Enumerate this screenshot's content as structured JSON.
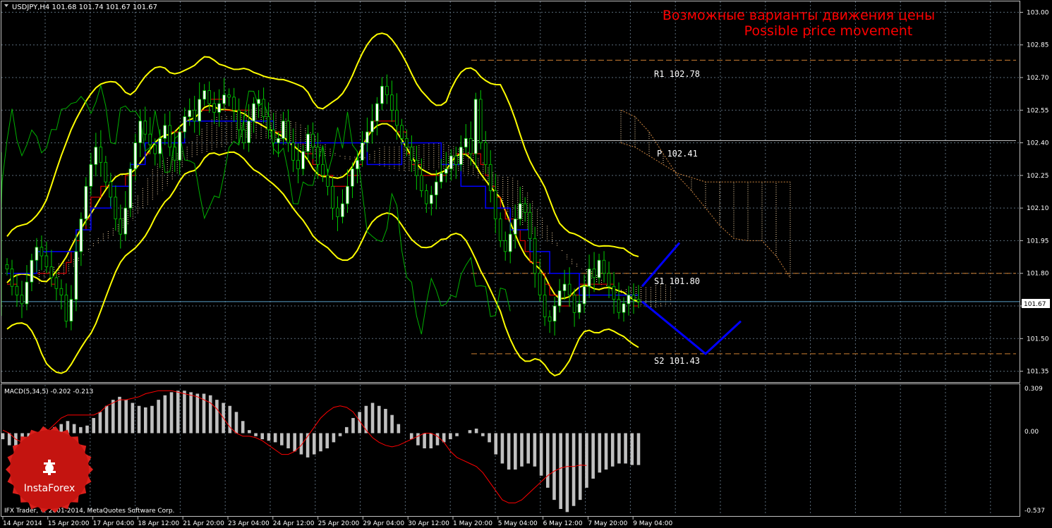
{
  "colors": {
    "background": "#000000",
    "grid": "#5a6b7a",
    "border": "#c0c0c0",
    "text": "#ffffff",
    "bull": "#ffffff",
    "bear": "#000000",
    "candle_outline": "#00cc00",
    "bollinger": "#ffff00",
    "tenkan": "#ff0000",
    "kijun": "#0000ff",
    "chikou": "#00b000",
    "kumo": "#ffdead",
    "kumo_edge": "#cd853f",
    "level_line": "#cd7f32",
    "pivot_line": "#c0c0c0",
    "bid_line": "#5aa0c8",
    "forecast": "#0000ff",
    "annotation": "#ff0000",
    "macd_hist": "#c0c0c0",
    "macd_signal": "#ff0000",
    "logo_red": "#d9201c"
  },
  "header": {
    "symbol_info": "USDJPY,H4  101.68 101.74 101.67 101.67"
  },
  "annotation": {
    "line1": "Возможные варианты движения цены",
    "line2": "Possible price movement"
  },
  "levels": [
    {
      "name": "R1",
      "label": "R1 102.78",
      "price": 102.78
    },
    {
      "name": "P",
      "label": "P 102.41",
      "price": 102.41
    },
    {
      "name": "S1",
      "label": "S1 101.80",
      "price": 101.8
    },
    {
      "name": "S2",
      "label": "S2 101.43",
      "price": 101.43
    }
  ],
  "price_axis": {
    "ticks": [
      "103.00",
      "102.85",
      "102.70",
      "102.55",
      "102.40",
      "102.25",
      "102.10",
      "101.95",
      "101.80",
      "101.65",
      "101.50",
      "101.35"
    ],
    "current": "101.67",
    "min": 101.3,
    "max": 103.05
  },
  "macd": {
    "label": "MACD(5,34,5) -0.202 -0.213",
    "ticks": [
      "0.309",
      "0.00",
      "-0.537"
    ],
    "max": 0.309,
    "min": -0.537
  },
  "time_axis": {
    "labels": [
      "14 Apr 2014",
      "15 Apr 20:00",
      "17 Apr 04:00",
      "18 Apr 12:00",
      "21 Apr 20:00",
      "23 Apr 04:00",
      "24 Apr 12:00",
      "25 Apr 20:00",
      "29 Apr 04:00",
      "30 Apr 12:00",
      "1 May 20:00",
      "5 May 04:00",
      "6 May 12:00",
      "7 May 20:00",
      "9 May 04:00"
    ]
  },
  "footer": {
    "copyright": "IFX Trader, © 2001-2014, MetaQuotes Software Corp."
  },
  "logo": {
    "text": "InstaForex"
  },
  "chart_data": {
    "type": "candlestick",
    "symbol": "USDJPY",
    "timeframe": "H4",
    "ohlc_current": {
      "open": 101.68,
      "high": 101.74,
      "low": 101.67,
      "close": 101.67
    },
    "close": [
      101.82,
      101.74,
      101.7,
      101.66,
      101.76,
      101.86,
      101.92,
      101.88,
      101.83,
      101.78,
      101.73,
      101.7,
      101.58,
      101.68,
      101.9,
      102.05,
      102.2,
      102.3,
      102.38,
      102.31,
      102.22,
      102.15,
      102.05,
      101.98,
      102.1,
      102.28,
      102.4,
      102.5,
      102.44,
      102.39,
      102.35,
      102.42,
      102.48,
      102.38,
      102.32,
      102.45,
      102.52,
      102.55,
      102.5,
      102.6,
      102.64,
      102.58,
      102.54,
      102.58,
      102.62,
      102.61,
      102.55,
      102.46,
      102.4,
      102.5,
      102.58,
      102.6,
      102.52,
      102.46,
      102.4,
      102.42,
      102.5,
      102.4,
      102.32,
      102.28,
      102.36,
      102.44,
      102.38,
      102.3,
      102.25,
      102.2,
      102.1,
      102.06,
      102.12,
      102.2,
      102.28,
      102.32,
      102.4,
      102.45,
      102.5,
      102.58,
      102.66,
      102.62,
      102.55,
      102.48,
      102.42,
      102.38,
      102.32,
      102.25,
      102.18,
      102.12,
      102.16,
      102.22,
      102.26,
      102.28,
      102.34,
      102.3,
      102.38,
      102.42,
      102.35,
      102.6,
      102.4,
      102.3,
      102.18,
      102.05,
      101.95,
      101.9,
      101.98,
      102.05,
      102.12,
      102.08,
      101.96,
      101.8,
      101.7,
      101.6,
      101.58,
      101.65,
      101.72,
      101.75,
      101.7,
      101.62,
      101.66,
      101.74,
      101.82,
      101.78,
      101.86,
      101.8,
      101.74,
      101.68,
      101.62,
      101.66,
      101.7,
      101.68,
      101.67
    ],
    "pivot_levels": {
      "R1": 102.78,
      "P": 102.41,
      "S1": 101.8,
      "S2": 101.43
    },
    "indicators": [
      "Bollinger Bands",
      "Ichimoku Kinko Hyo",
      "MACD(5,34,5)"
    ],
    "forecast_paths": [
      {
        "direction": "up",
        "points": [
          101.74,
          101.94
        ]
      },
      {
        "direction": "down",
        "points": [
          101.67,
          101.43,
          101.58
        ]
      }
    ],
    "macd_values": [
      -0.04,
      -0.08,
      -0.1,
      -0.12,
      -0.1,
      -0.06,
      -0.02,
      0.02,
      0.04,
      0.06,
      0.08,
      0.06,
      0.04,
      0.05,
      0.1,
      0.14,
      0.18,
      0.22,
      0.24,
      0.22,
      0.2,
      0.18,
      0.17,
      0.18,
      0.22,
      0.25,
      0.27,
      0.28,
      0.28,
      0.27,
      0.26,
      0.26,
      0.25,
      0.22,
      0.2,
      0.18,
      0.14,
      0.08,
      0.02,
      -0.02,
      -0.04,
      -0.05,
      -0.06,
      -0.08,
      -0.1,
      -0.12,
      -0.14,
      -0.16,
      -0.14,
      -0.12,
      -0.1,
      -0.06,
      -0.02,
      0.04,
      0.1,
      0.14,
      0.18,
      0.2,
      0.18,
      0.16,
      0.12,
      0.06,
      0.0,
      -0.04,
      -0.08,
      -0.1,
      -0.1,
      -0.08,
      -0.06,
      -0.04,
      -0.02,
      0.0,
      0.02,
      0.03,
      -0.02,
      -0.06,
      -0.14,
      -0.2,
      -0.24,
      -0.24,
      -0.22,
      -0.2,
      -0.22,
      -0.28,
      -0.36,
      -0.44,
      -0.5,
      -0.52,
      -0.48,
      -0.44,
      -0.36,
      -0.3,
      -0.26,
      -0.24,
      -0.22,
      -0.2,
      -0.2,
      -0.21,
      -0.21
    ],
    "macd_signal": [
      0.02,
      0.0,
      -0.04,
      -0.06,
      -0.06,
      -0.04,
      0.0,
      0.02,
      0.06,
      0.1,
      0.12,
      0.12,
      0.12,
      0.12,
      0.12,
      0.14,
      0.18,
      0.2,
      0.22,
      0.22,
      0.23,
      0.24,
      0.26,
      0.27,
      0.28,
      0.28,
      0.28,
      0.27,
      0.26,
      0.25,
      0.24,
      0.22,
      0.2,
      0.16,
      0.1,
      0.04,
      0.0,
      -0.02,
      -0.02,
      -0.03,
      -0.05,
      -0.08,
      -0.11,
      -0.14,
      -0.14,
      -0.12,
      -0.08,
      -0.02,
      0.04,
      0.1,
      0.14,
      0.17,
      0.18,
      0.17,
      0.14,
      0.08,
      0.02,
      -0.03,
      -0.06,
      -0.08,
      -0.09,
      -0.08,
      -0.06,
      -0.04,
      -0.02,
      0.0,
      0.0,
      -0.02,
      -0.06,
      -0.12,
      -0.16,
      -0.18,
      -0.2,
      -0.22,
      -0.26,
      -0.32,
      -0.38,
      -0.44,
      -0.46,
      -0.46,
      -0.44,
      -0.4,
      -0.36,
      -0.32,
      -0.28,
      -0.25,
      -0.23,
      -0.22,
      -0.22,
      -0.21,
      -0.213
    ]
  }
}
